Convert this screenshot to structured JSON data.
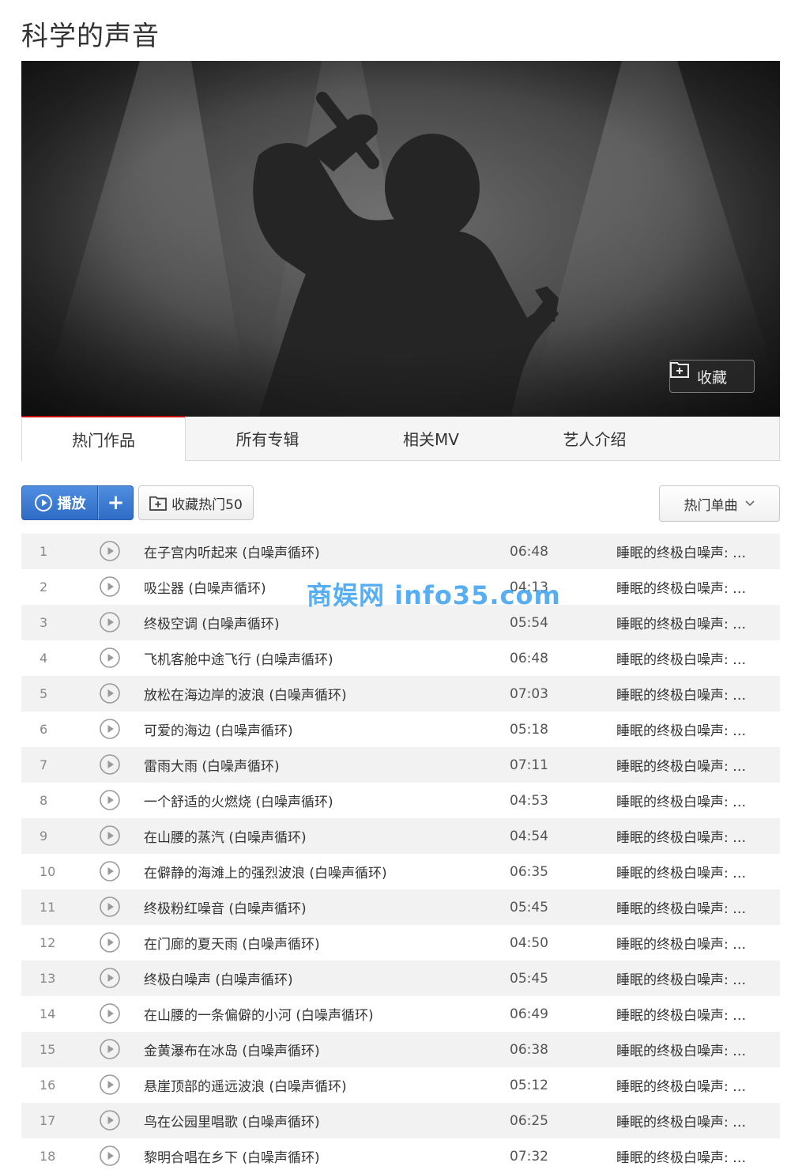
{
  "page": {
    "title": "科学的声音"
  },
  "banner": {
    "image": "singer-silhouette-spotlight",
    "favorite_label": "收藏"
  },
  "tabs": [
    {
      "label": "热门作品",
      "active": true
    },
    {
      "label": "所有专辑",
      "active": false
    },
    {
      "label": "相关MV",
      "active": false
    },
    {
      "label": "艺人介绍",
      "active": false
    }
  ],
  "toolbar": {
    "play_label": "播放",
    "add_label": "+",
    "collect_label": "收藏热门50",
    "sort_label": "热门单曲"
  },
  "watermark": "商娱网 info35.com",
  "songs": [
    {
      "num": "1",
      "title": "在子宫内听起来 (白噪声循环)",
      "duration": "06:48",
      "album": "睡眠的终极白噪声: …"
    },
    {
      "num": "2",
      "title": "吸尘器 (白噪声循环)",
      "duration": "04:13",
      "album": "睡眠的终极白噪声: …"
    },
    {
      "num": "3",
      "title": "终极空调 (白噪声循环)",
      "duration": "05:54",
      "album": "睡眠的终极白噪声: …"
    },
    {
      "num": "4",
      "title": "飞机客舱中途飞行 (白噪声循环)",
      "duration": "06:48",
      "album": "睡眠的终极白噪声: …"
    },
    {
      "num": "5",
      "title": "放松在海边岸的波浪 (白噪声循环)",
      "duration": "07:03",
      "album": "睡眠的终极白噪声: …"
    },
    {
      "num": "6",
      "title": "可爱的海边 (白噪声循环)",
      "duration": "05:18",
      "album": "睡眠的终极白噪声: …"
    },
    {
      "num": "7",
      "title": "雷雨大雨 (白噪声循环)",
      "duration": "07:11",
      "album": "睡眠的终极白噪声: …"
    },
    {
      "num": "8",
      "title": "一个舒适的火燃烧 (白噪声循环)",
      "duration": "04:53",
      "album": "睡眠的终极白噪声: …"
    },
    {
      "num": "9",
      "title": "在山腰的蒸汽 (白噪声循环)",
      "duration": "04:54",
      "album": "睡眠的终极白噪声: …"
    },
    {
      "num": "10",
      "title": "在僻静的海滩上的强烈波浪 (白噪声循环)",
      "duration": "06:35",
      "album": "睡眠的终极白噪声: …"
    },
    {
      "num": "11",
      "title": "终极粉红噪音 (白噪声循环)",
      "duration": "05:45",
      "album": "睡眠的终极白噪声: …"
    },
    {
      "num": "12",
      "title": "在门廊的夏天雨 (白噪声循环)",
      "duration": "04:50",
      "album": "睡眠的终极白噪声: …"
    },
    {
      "num": "13",
      "title": "终极白噪声 (白噪声循环)",
      "duration": "05:45",
      "album": "睡眠的终极白噪声: …"
    },
    {
      "num": "14",
      "title": "在山腰的一条偏僻的小河 (白噪声循环)",
      "duration": "06:49",
      "album": "睡眠的终极白噪声: …"
    },
    {
      "num": "15",
      "title": "金黄瀑布在冰岛 (白噪声循环)",
      "duration": "06:38",
      "album": "睡眠的终极白噪声: …"
    },
    {
      "num": "16",
      "title": "悬崖顶部的遥远波浪 (白噪声循环)",
      "duration": "05:12",
      "album": "睡眠的终极白噪声: …"
    },
    {
      "num": "17",
      "title": "鸟在公园里唱歌 (白噪声循环)",
      "duration": "06:25",
      "album": "睡眠的终极白噪声: …"
    },
    {
      "num": "18",
      "title": "黎明合唱在乡下 (白噪声循环)",
      "duration": "07:32",
      "album": "睡眠的终极白噪声: …"
    }
  ],
  "colors": {
    "accent_red": "#c20c0c",
    "play_blue": "#2f6cc6",
    "row_alt": "#f2f2f2"
  }
}
